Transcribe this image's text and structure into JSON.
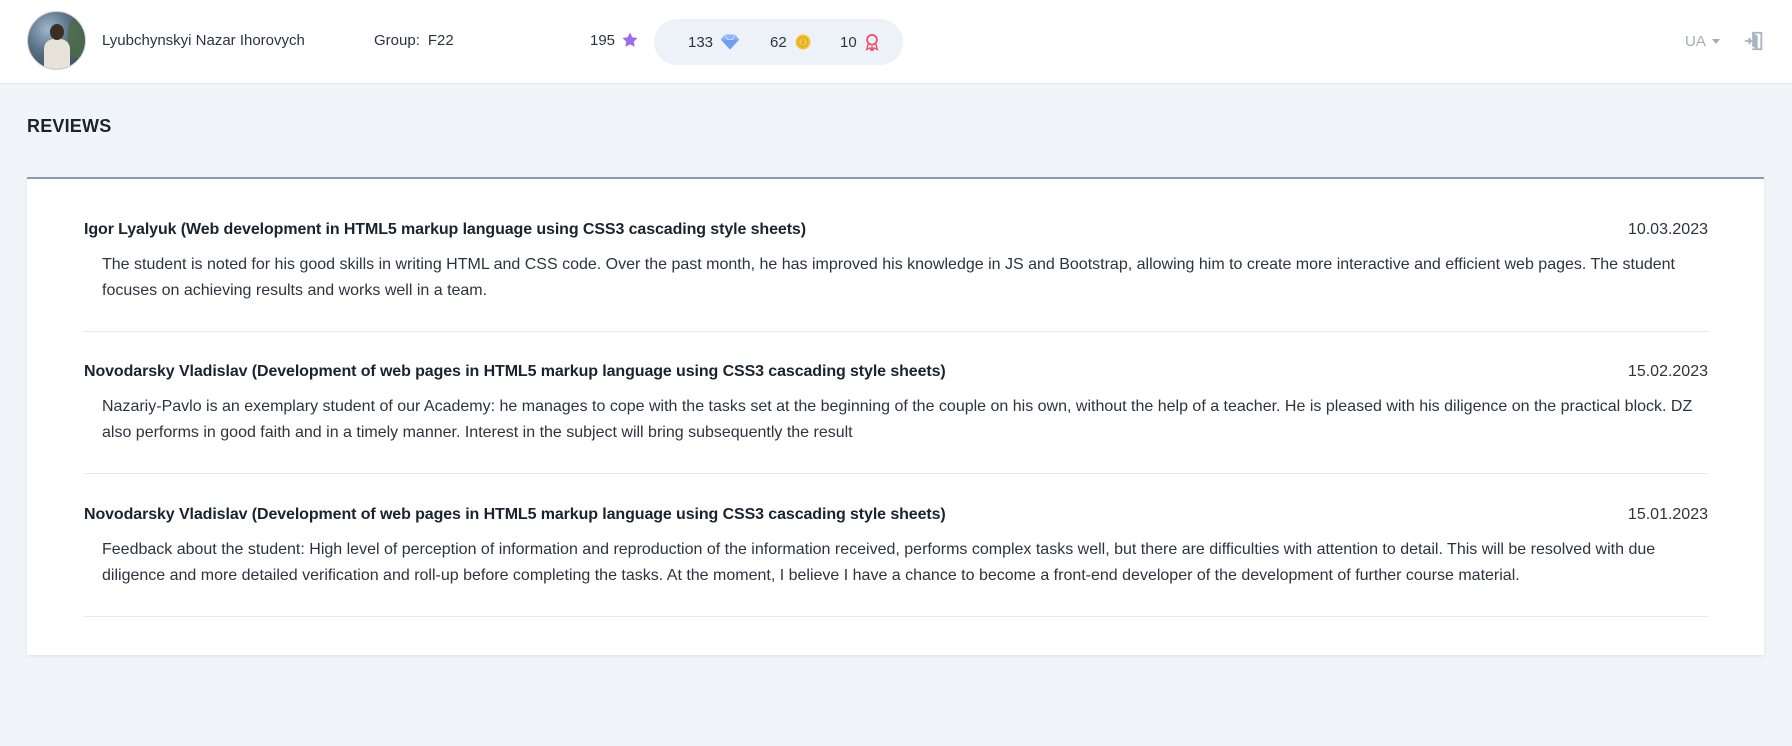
{
  "user": {
    "name": "Lyubchynskyi Nazar Ihorovych",
    "group_label": "Group:",
    "group_value": "F22",
    "stars": "195"
  },
  "stats": {
    "gems": "133",
    "coins": "62",
    "badges": "10"
  },
  "language": "UA",
  "page_title": "REVIEWS",
  "reviews": [
    {
      "author": "Igor Lyalyuk (Web development in HTML5 markup language using CSS3 cascading style sheets)",
      "date": "10.03.2023",
      "text": "The student is noted for his good skills in writing HTML and CSS code. Over the past month, he has improved his knowledge in JS and Bootstrap, allowing him to create more interactive and efficient web pages. The student focuses on achieving results and works well in a team."
    },
    {
      "author": "Novodarsky Vladislav (Development of web pages in HTML5 markup language using CSS3 cascading style sheets)",
      "date": "15.02.2023",
      "text": "Nazariy-Pavlo is an exemplary student of our Academy: he manages to cope with the tasks set at the beginning of the couple on his own, without the help of a teacher. He is pleased with his diligence on the practical block. DZ also performs in good faith and in a timely manner. Interest in the subject will bring subsequently the result"
    },
    {
      "author": "Novodarsky Vladislav (Development of web pages in HTML5 markup language using CSS3 cascading style sheets)",
      "date": "15.01.2023",
      "text": "Feedback about the student: High level of perception of information and reproduction of the information received, performs complex tasks well, but there are difficulties with attention to detail. This will be resolved with due diligence and more detailed verification and roll-up before completing the tasks. At the moment, I believe I have a chance to become a front-end developer of the development of further course material."
    }
  ],
  "icons": {
    "star": "star-icon",
    "gem": "diamond-icon",
    "coin": "coin-icon",
    "badge": "award-icon",
    "logout": "logout-icon"
  },
  "colors": {
    "star": "#9b6cf0",
    "gem": "#6f9df5",
    "coin": "#f5c33b",
    "badge": "#f0566e",
    "accent_border": "#8c9bb5",
    "background": "#f1f5f9"
  }
}
